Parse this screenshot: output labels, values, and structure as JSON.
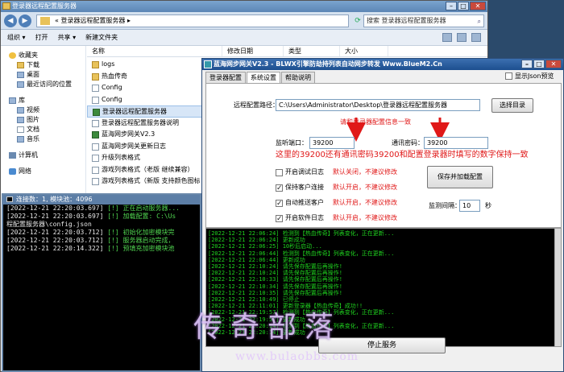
{
  "explorer": {
    "title": "登录器远程配置服务器",
    "path": "« 登录器远程配置服务器 ▸",
    "search_placeholder": "搜索 登录器远程配置服务器",
    "toolbar": [
      "组织 ▾",
      "打开",
      "共享 ▾",
      "新建文件夹"
    ],
    "nav": [
      {
        "label": "收藏夹",
        "icon": "star-icon",
        "type": "header"
      },
      {
        "label": "下载",
        "icon": "folder-icon",
        "type": "sub"
      },
      {
        "label": "桌面",
        "icon": "desktop-icon",
        "type": "sub"
      },
      {
        "label": "最近访问的位置",
        "icon": "recent-icon",
        "type": "sub"
      },
      {
        "label": "库",
        "icon": "library-icon",
        "type": "header"
      },
      {
        "label": "视频",
        "icon": "video-icon",
        "type": "sub"
      },
      {
        "label": "图片",
        "icon": "picture-icon",
        "type": "sub"
      },
      {
        "label": "文档",
        "icon": "document-icon",
        "type": "sub"
      },
      {
        "label": "音乐",
        "icon": "music-icon",
        "type": "sub"
      },
      {
        "label": "计算机",
        "icon": "computer-icon",
        "type": "header"
      },
      {
        "label": "网络",
        "icon": "network-icon",
        "type": "header"
      }
    ],
    "columns": [
      "名称",
      "修改日期",
      "类型",
      "大小"
    ],
    "files": [
      {
        "name": "logs",
        "icon": "folder-icon"
      },
      {
        "name": "热血传奇",
        "icon": "folder-icon"
      },
      {
        "name": "Config",
        "icon": "config-file-icon"
      },
      {
        "name": "Config",
        "icon": "config-file-icon"
      },
      {
        "name": "登录器远程配置服务器",
        "icon": "exe-icon",
        "selected": true
      },
      {
        "name": "登录器远程配置服务器说明",
        "icon": "text-file-icon"
      },
      {
        "name": "蓝海网步网关V2.3",
        "icon": "exe-icon"
      },
      {
        "name": "蓝海网步网关更新日志",
        "icon": "text-file-icon"
      },
      {
        "name": "升级列表格式",
        "icon": "text-file-icon"
      },
      {
        "name": "游戏列表格式（老版 继续兼容）",
        "icon": "text-file-icon"
      },
      {
        "name": "游戏列表格式（新版 支持颜色图标",
        "icon": "text-file-icon"
      }
    ]
  },
  "console": {
    "title": "连接数：1, 模块池：4096",
    "lines": [
      {
        "ts": "[2022-12-21 22:20:03.697]",
        "msg": "[!] 正在启动服务器..."
      },
      {
        "ts": "[2022-12-21 22:20:03.697]",
        "msg": "[!] 加载配置: C:\\Us"
      },
      {
        "ts": "程配置服务器\\config.json",
        "msg": ""
      },
      {
        "ts": "[2022-12-21 22:20:03.712]",
        "msg": "[!] 初始化加密模块完"
      },
      {
        "ts": "[2022-12-21 22:20:03.712]",
        "msg": "[!] 服务器启动完成，"
      },
      {
        "ts": "[2022-12-21 22:20:14.322]",
        "msg": "[!] 预填充加密模块池"
      }
    ]
  },
  "tool": {
    "title": "蓝海网步网关V2.3 - BLWX引擎防劫持列表自动网步转发 Www.BlueM2.Cn",
    "tabs": [
      "登录器配置",
      "系统设置",
      "帮助说明"
    ],
    "active_tab": "系统设置",
    "json_preview_label": "显示Json预览",
    "remote_path_label": "远程配置路径：",
    "remote_path_value": "C:\\Users\\Administrator\\Desktop\\登录器远程配置服务器",
    "select_dir_button": "选择目录",
    "hint_top": "请和登录器配置信息一致",
    "listen_port_label": "监听端口：",
    "listen_port_value": "39200",
    "comm_password_label": "通讯密码：",
    "comm_password_value": "39200",
    "hint_mid": "这里的39200还有通讯密码39200和配置登录器时填写的数字保持一致",
    "options": [
      {
        "label": "开启调试日志",
        "checked": false,
        "note": "默认关闭，不建议修改"
      },
      {
        "label": "保持客户连接",
        "checked": true,
        "note": "默认开启，不建议修改"
      },
      {
        "label": "自动推送客户",
        "checked": true,
        "note": "默认开启，不建议修改"
      },
      {
        "label": "开启软件日志",
        "checked": true,
        "note": "默认开启，不建议修改"
      }
    ],
    "save_button": "保存并加载配置",
    "check_interval_label": "监测间隔：",
    "check_interval_value": "10",
    "check_interval_unit": "秒",
    "stop_button": "停止服务",
    "log": [
      "[2022-12-21 22:06:24] 检测到【热血传奇】列表变化，正在更新...",
      "[2022-12-21 22:06:24] 更新成功",
      "[2022-12-21 22:06:25] 10秒后启动...",
      "[2022-12-21 22:06:44] 检测到【热血传奇】列表变化，正在更新...",
      "[2022-12-21 22:06:44] 更新成功",
      "[2022-12-21 22:10:24] 请先保存配置后再操作!",
      "[2022-12-21 22:10:24] 请先保存配置后再操作!",
      "[2022-12-21 22:10:33] 请先保存配置后再操作!",
      "[2022-12-21 22:10:34] 请先保存配置后再操作!",
      "[2022-12-21 22:10:35] 请先保存配置后再操作!",
      "[2022-12-21 22:10:49] 已停止",
      "[2022-12-21 22:11:01] 更新登录器【热血传奇】成功!!",
      "[2022-12-21 22:19:57] 检测到【热血传奇】列表变化，正在更新...",
      "[2022-12-21 22:19:57] 更新成功",
      "[2022-12-21 22:20:14] 检测到【热血传奇】列表变化，正在更新...",
      "[2022-12-21 22:20:14] 更新成功"
    ]
  },
  "watermark": {
    "text": "传奇部落",
    "url": "www.bulaobbs.com"
  }
}
